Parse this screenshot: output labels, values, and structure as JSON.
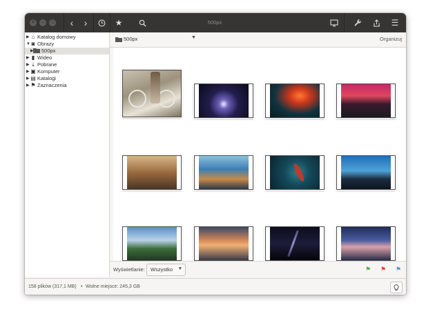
{
  "window": {
    "title": "500px"
  },
  "toolbar": {
    "back_icon": "chevron-left-icon",
    "forward_icon": "chevron-right-icon",
    "history_icon": "clock-icon",
    "favorites_icon": "star-icon",
    "search_icon": "search-icon",
    "slideshow_icon": "monitor-icon",
    "tools_icon": "wrench-icon",
    "share_icon": "share-icon",
    "menu_icon": "hamburger-menu-icon"
  },
  "sidebar": {
    "items": [
      {
        "label": "Katalog domowy",
        "icon": "home-icon",
        "expanded": false
      },
      {
        "label": "Obrazy",
        "icon": "camera-icon",
        "expanded": true
      },
      {
        "label": "500px",
        "icon": "folder-icon",
        "expanded": false,
        "selected": true
      },
      {
        "label": "Wideo",
        "icon": "film-icon",
        "expanded": false
      },
      {
        "label": "Pobrane",
        "icon": "download-icon",
        "expanded": false
      },
      {
        "label": "Komputer",
        "icon": "computer-icon",
        "expanded": false
      },
      {
        "label": "Katalogi",
        "icon": "catalog-icon",
        "expanded": false
      },
      {
        "label": "Zaznaczenia",
        "icon": "flag-icon",
        "expanded": false
      }
    ]
  },
  "pathbar": {
    "folder": "500px",
    "organize_label": "Organizuj"
  },
  "filter": {
    "label": "Wyświetlanie:",
    "value": "Wszystko"
  },
  "flags": [
    {
      "name": "green-flag-icon",
      "color": "#4caf50"
    },
    {
      "name": "red-flag-icon",
      "color": "#e53935"
    },
    {
      "name": "blue-flag-icon",
      "color": "#5c8fd6"
    }
  ],
  "status": {
    "files": "158 plików (317,1 MB)",
    "separator": "•",
    "free_space": "Wolne miejsce: 245,3 GB"
  },
  "colors": {
    "titlebar": "#373533",
    "accent_selection": "#e3e1de"
  }
}
